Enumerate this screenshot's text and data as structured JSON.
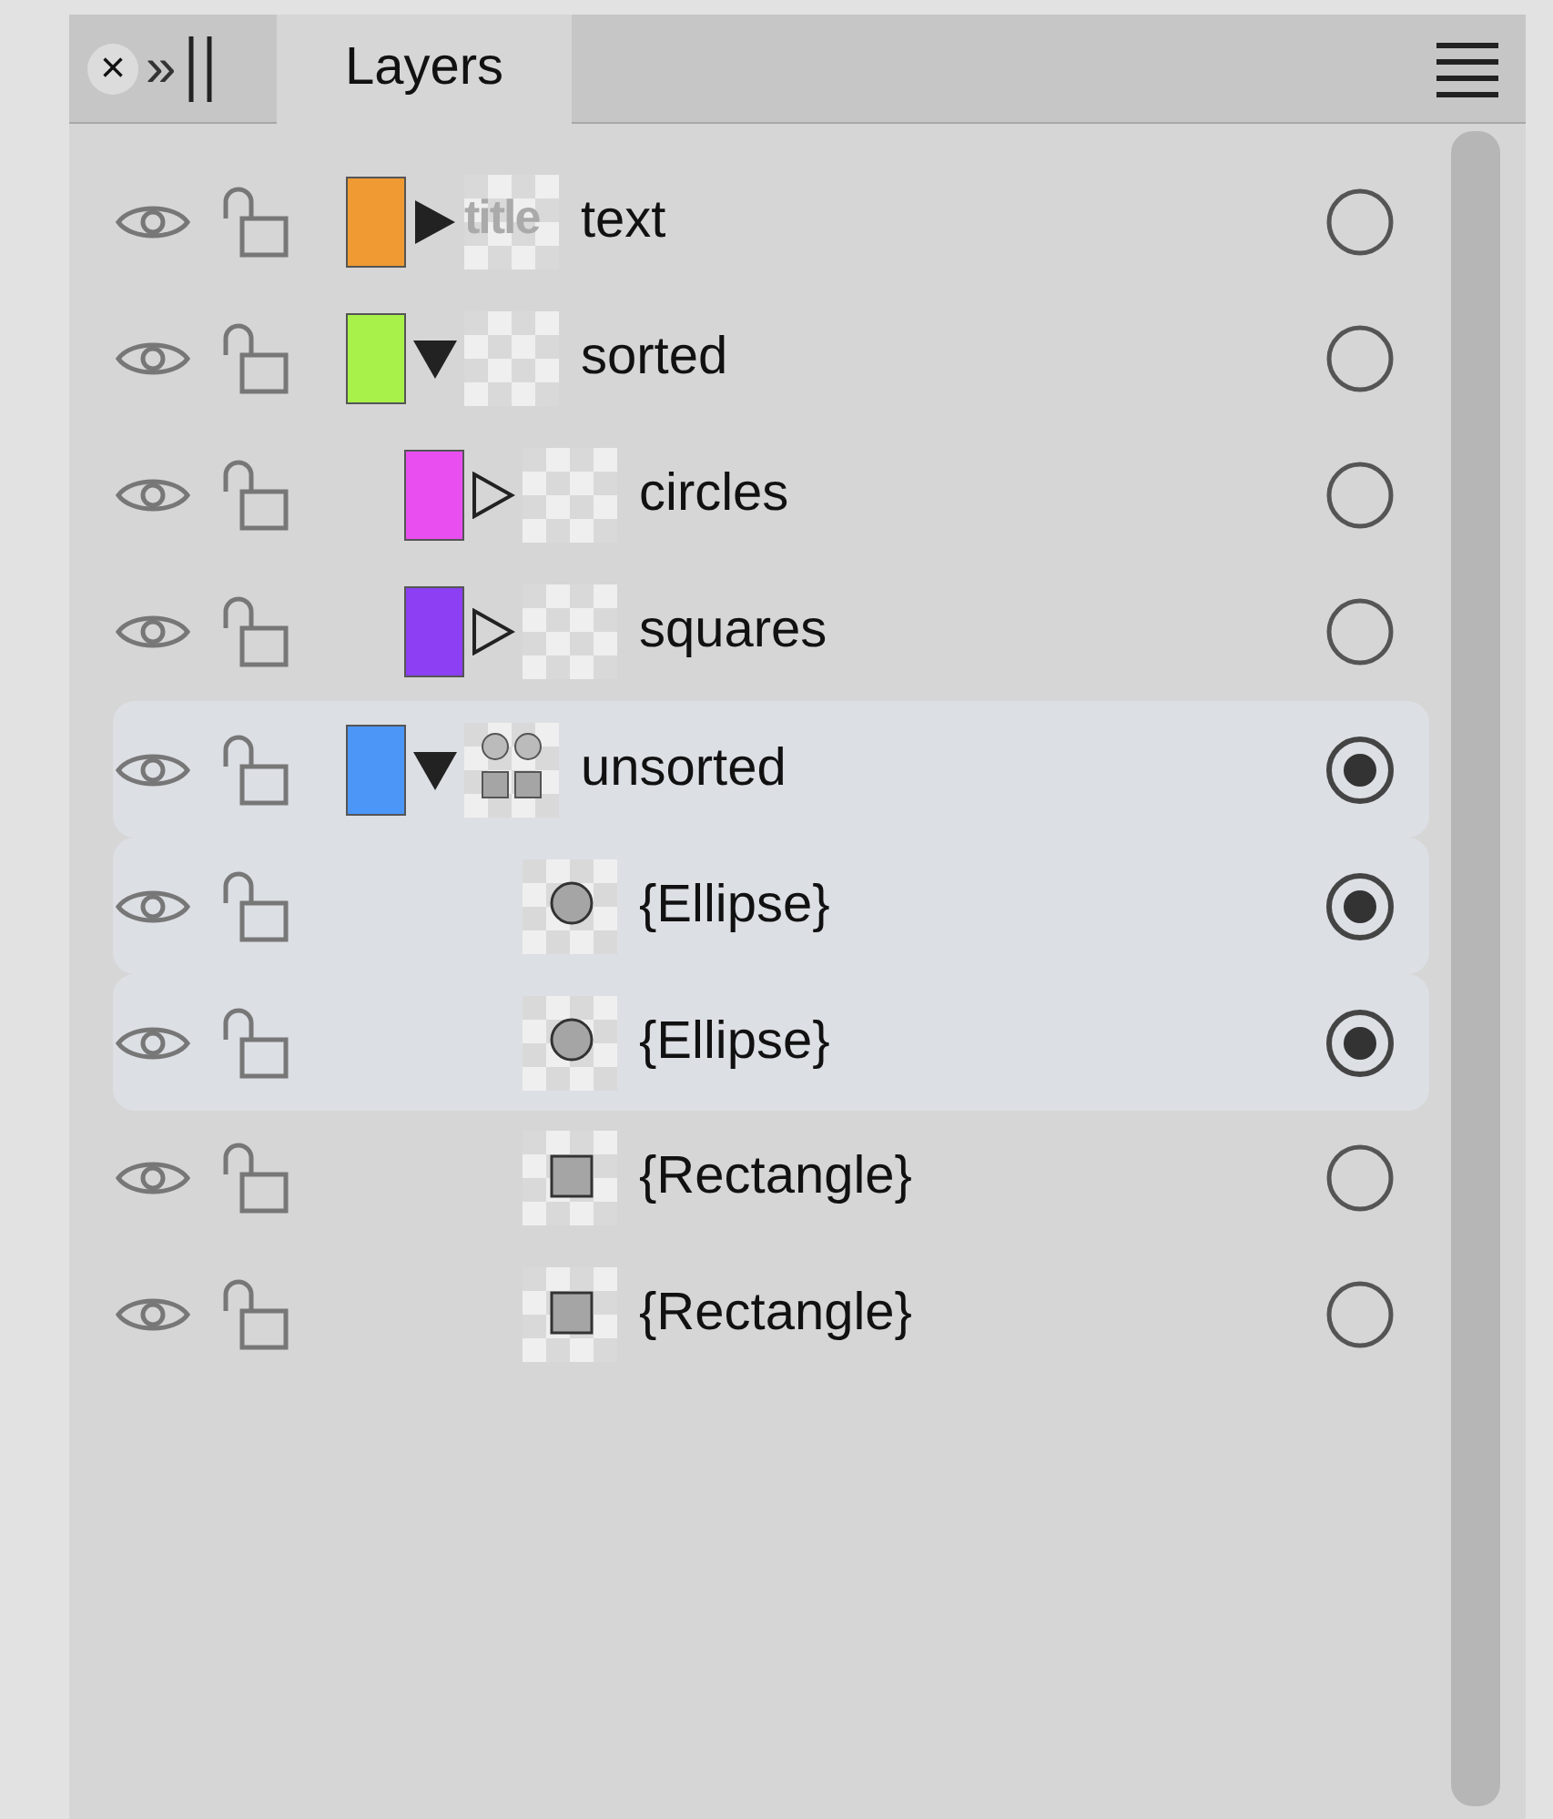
{
  "panel": {
    "close_glyph": "×",
    "collapse_glyph": "»",
    "tabs": [
      {
        "label": "Layers",
        "selected": true
      }
    ]
  },
  "layers": [
    {
      "name": "text",
      "kind": "text",
      "thumbnail_text": "title",
      "color": "#ef9a33",
      "expanded": false,
      "has_content": true,
      "selected": false
    },
    {
      "name": "sorted",
      "kind": "group",
      "color": "#a8f14a",
      "expanded": true,
      "selected": false,
      "children": [
        {
          "name": "circles",
          "kind": "group",
          "color": "#e94ff0",
          "expanded": false,
          "selected": false
        },
        {
          "name": "squares",
          "kind": "group",
          "color": "#8c3ff3",
          "expanded": false,
          "selected": false
        }
      ]
    },
    {
      "name": "unsorted",
      "kind": "shapes",
      "color": "#4b96f7",
      "expanded": true,
      "selected": true,
      "children": [
        {
          "name": "{Ellipse}",
          "kind": "ellipse",
          "selected": true
        },
        {
          "name": "{Ellipse}",
          "kind": "ellipse",
          "selected": true
        },
        {
          "name": "{Rectangle}",
          "kind": "rectangle",
          "selected": false
        },
        {
          "name": "{Rectangle}",
          "kind": "rectangle",
          "selected": false
        }
      ]
    }
  ]
}
